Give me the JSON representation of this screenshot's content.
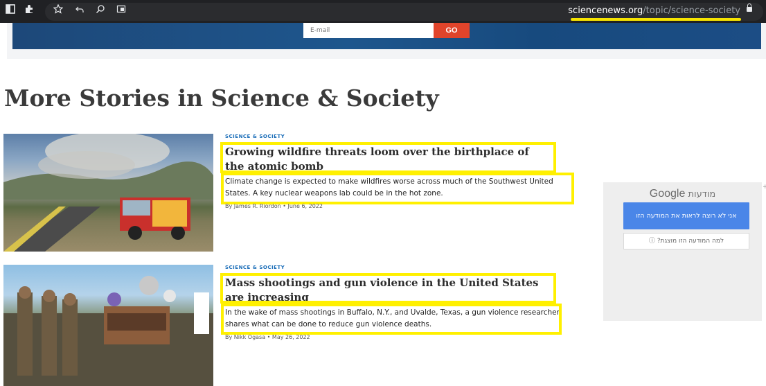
{
  "browser": {
    "url_domain": "sciencenews.org",
    "url_path": "/topic/science-society",
    "icons": [
      "sidebar-icon",
      "extensions-icon",
      "star-icon",
      "share-icon",
      "search-icon",
      "install-icon",
      "lock-icon"
    ]
  },
  "newsletter": {
    "email_placeholder": "E-mail",
    "go_label": "GO"
  },
  "section": {
    "title": "More Stories in Science & Society"
  },
  "stories": [
    {
      "kicker": "SCIENCE & SOCIETY",
      "headline": "Growing wildfire threats loom over the birthplace of the atomic bomb",
      "summary": "Climate change is expected to make wildfires worse across much of the Southwest United States. A key nuclear weapons lab could be in the hot zone.",
      "byline": "By James R. Riordon • June 6, 2022"
    },
    {
      "kicker": "SCIENCE & SOCIETY",
      "headline": "Mass shootings and gun violence in the United States are increasing",
      "summary": "In the wake of mass shootings in Buffalo, N.Y., and Uvalde, Texas, a gun violence researcher shares what can be done to reduce gun violence deaths.",
      "byline": "By Nikk Ogasa • May 26, 2022"
    }
  ],
  "ad": {
    "brand": "Google",
    "label": "מודעות",
    "hide_button": "אני לא רוצה לראות את המודעה הזו",
    "why_link": "למה המודעה הזו מוצגת?",
    "info_glyph": "ⓘ"
  },
  "colors": {
    "highlight": "#fff000",
    "go_button": "#e0442b",
    "kicker": "#1a6db8",
    "ad_button": "#4a86e8"
  }
}
